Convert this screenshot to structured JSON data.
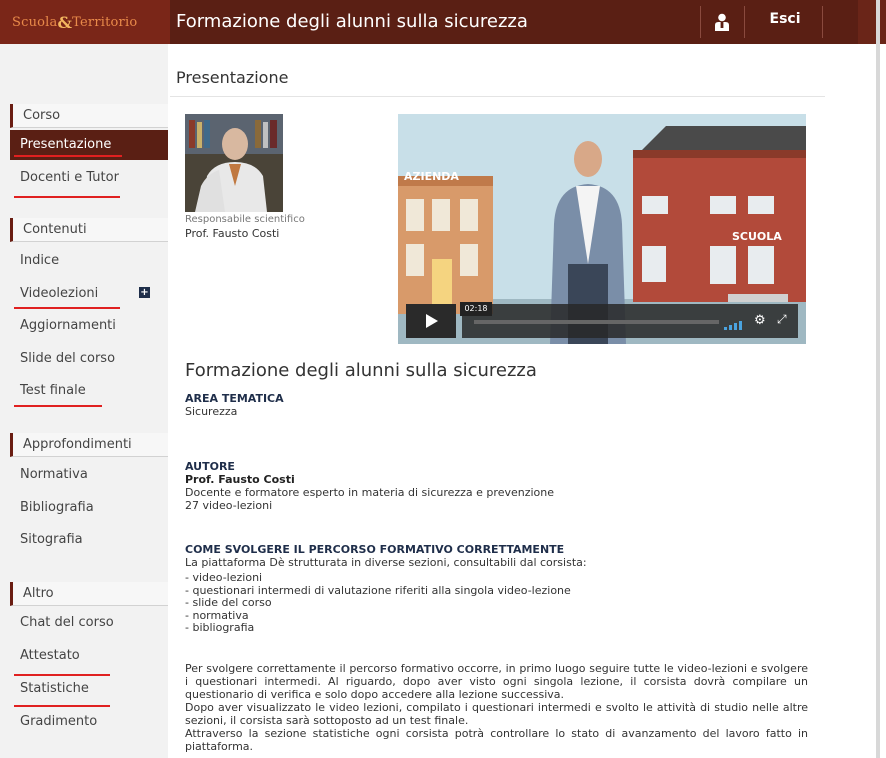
{
  "header": {
    "logo_part1": "Scuola",
    "logo_amp": "&",
    "logo_part2": "Territorio",
    "title": "Formazione degli alunni sulla sicurezza",
    "logout_label": "Esci"
  },
  "page": {
    "heading": "Presentazione"
  },
  "sidebar": {
    "sections": [
      {
        "title": "Corso",
        "items": [
          "Presentazione",
          "Docenti e Tutor"
        ]
      },
      {
        "title": "Contenuti",
        "items": [
          "Indice",
          "Videolezioni",
          "Aggiornamenti",
          "Slide del corso",
          "Test finale"
        ]
      },
      {
        "title": "Approfondimenti",
        "items": [
          "Normativa",
          "Bibliografia",
          "Sitografia"
        ]
      },
      {
        "title": "Altro",
        "items": [
          "Chat del corso",
          "Attestato",
          "Statistiche",
          "Gradimento"
        ]
      }
    ]
  },
  "profile": {
    "role": "Responsabile scientifico",
    "name": "Prof. Fausto Costi"
  },
  "video": {
    "label_left": "AZIENDA",
    "label_right": "SCUOLA",
    "time": "02:18"
  },
  "course": {
    "title": "Formazione degli alunni sulla sicurezza",
    "area_label": "AREA TEMATICA",
    "area_value": "Sicurezza",
    "author_label": "AUTORE",
    "author_name": "Prof. Fausto Costi",
    "author_desc": "Docente e formatore esperto in materia di sicurezza e prevenzione",
    "author_count": "27 video-lezioni",
    "howto_label": "COME SVOLGERE IL PERCORSO FORMATIVO CORRETTAMENTE",
    "howto_intro": "La piattaforma Dè strutturata in diverse sezioni, consultabili dal corsista:",
    "list": [
      "- video-lezioni",
      "- questionari intermedi di valutazione riferiti alla singola video-lezione",
      "- slide del corso",
      "- normativa",
      "- bibliografia"
    ],
    "para1": "Per svolgere correttamente il percorso formativo occorre, in primo luogo seguire tutte le video-lezioni e svolgere i questionari intermedi. Al riguardo, dopo aver visto ogni singola lezione, il corsista dovrà compilare un questionario di verifica e solo dopo accedere alla lezione successiva.",
    "para2": "Dopo aver visualizzato le video lezioni, compilato i questionari intermedi e svolto le attività di studio nelle altre sezioni, il corsista sarà sottoposto ad un test finale.",
    "para3": "Attraverso la sezione statistiche ogni corsista potrà controllare lo stato di avanzamento del lavoro fatto in piattaforma."
  }
}
